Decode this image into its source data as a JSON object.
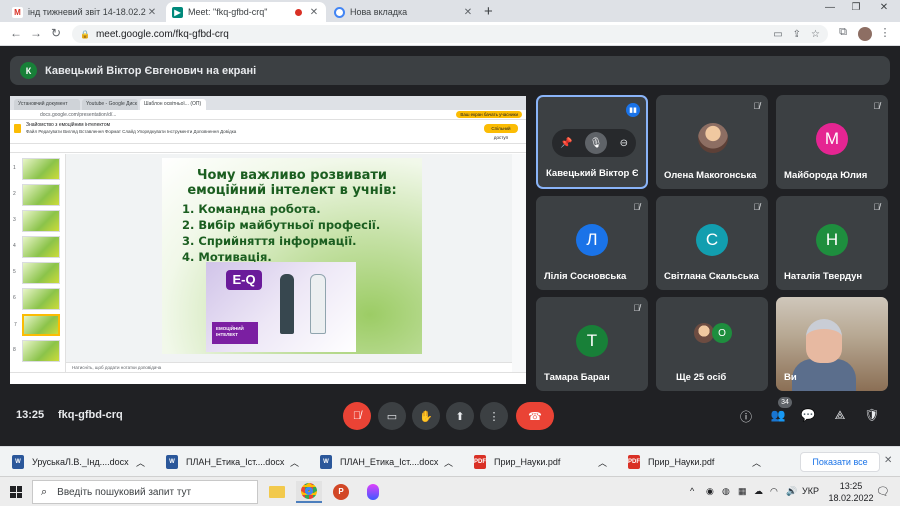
{
  "browser": {
    "tabs": [
      {
        "title": "інд тижневий звіт 14-18.02.2022",
        "icon": "gmail-icon",
        "active": false
      },
      {
        "title": "Meet: \"fkq-gfbd-crq\"",
        "icon": "meet-icon",
        "active": true
      },
      {
        "title": "Нова вкладка",
        "icon": "chrome-icon",
        "active": false
      }
    ],
    "url": "meet.google.com/fkq-gfbd-crq"
  },
  "banner": {
    "avatar_letter": "К",
    "text": "Кавецький Віктор Євгенович на екрані"
  },
  "shared_screen": {
    "inner_tabs": [
      "Установчий документ",
      "Youtube - Google Диск",
      "Шаблон освітньої... (ОП)"
    ],
    "inner_url": "docs.google.com/presentation/d/...",
    "notice": "Ваш екран бачать учасники",
    "doc_title": "Знайомство з емоційним інтелектом",
    "doc_menu": "Файл  Редагувати  Вигляд  Вставлення  Формат  Слайд  Упорядкувати  Інструменти  Доповнення  Довідка",
    "share_label": "Спільний доступ",
    "slide": {
      "heading": "Чому важливо розвивати емоційний інтелект в учнів:",
      "items": [
        "1. Командна робота.",
        "2. Вибір майбутньої професії.",
        "3. Сприйняття інформації.",
        "4. Мотивація."
      ],
      "badge": "E-Q",
      "caption": "ЕМОЦІЙНИЙ ІНТЕЛЕКТ"
    },
    "thumb_numbers": [
      "1",
      "2",
      "3",
      "4",
      "5",
      "6",
      "7",
      "8"
    ],
    "notes_placeholder": "Натисніть, щоб додати нотатки доповідача"
  },
  "participants": [
    {
      "name": "Кавецький Віктор Є...",
      "type": "hover",
      "speaking": true
    },
    {
      "name": "Олена Макогонська",
      "type": "photo"
    },
    {
      "name": "Майборода Юлия",
      "type": "letter",
      "letter": "М",
      "color": "#e52592"
    },
    {
      "name": "Лілія Сосновська",
      "type": "letter",
      "letter": "Л",
      "color": "#1a73e8"
    },
    {
      "name": "Світлана Скальська",
      "type": "letter",
      "letter": "С",
      "color": "#129eaf"
    },
    {
      "name": "Наталія Твердун",
      "type": "letter",
      "letter": "Н",
      "color": "#1e8e3e"
    },
    {
      "name": "Тамара Баран",
      "type": "letter",
      "letter": "Т",
      "color": "#188038"
    },
    {
      "name": "Ще 25 осіб",
      "type": "more",
      "letter": "О"
    },
    {
      "name": "Ви",
      "type": "video"
    }
  ],
  "meetbar": {
    "time": "13:25",
    "code": "fkq-gfbd-crq",
    "people_count": "34"
  },
  "downloads": [
    {
      "name": "УруськаЛ.В._Інд....docx",
      "type": "doc"
    },
    {
      "name": "ПЛАН_Етика_Іст....docx",
      "type": "doc"
    },
    {
      "name": "ПЛАН_Етика_Іст....docx",
      "type": "doc"
    },
    {
      "name": "Прир_Науки.pdf",
      "type": "pdf"
    },
    {
      "name": "Прир_Науки.pdf",
      "type": "pdf"
    }
  ],
  "downloads_show_all": "Показати все",
  "taskbar": {
    "search_placeholder": "Введіть пошуковий запит тут",
    "language": "УКР",
    "time": "13:25",
    "date": "18.02.2022"
  }
}
